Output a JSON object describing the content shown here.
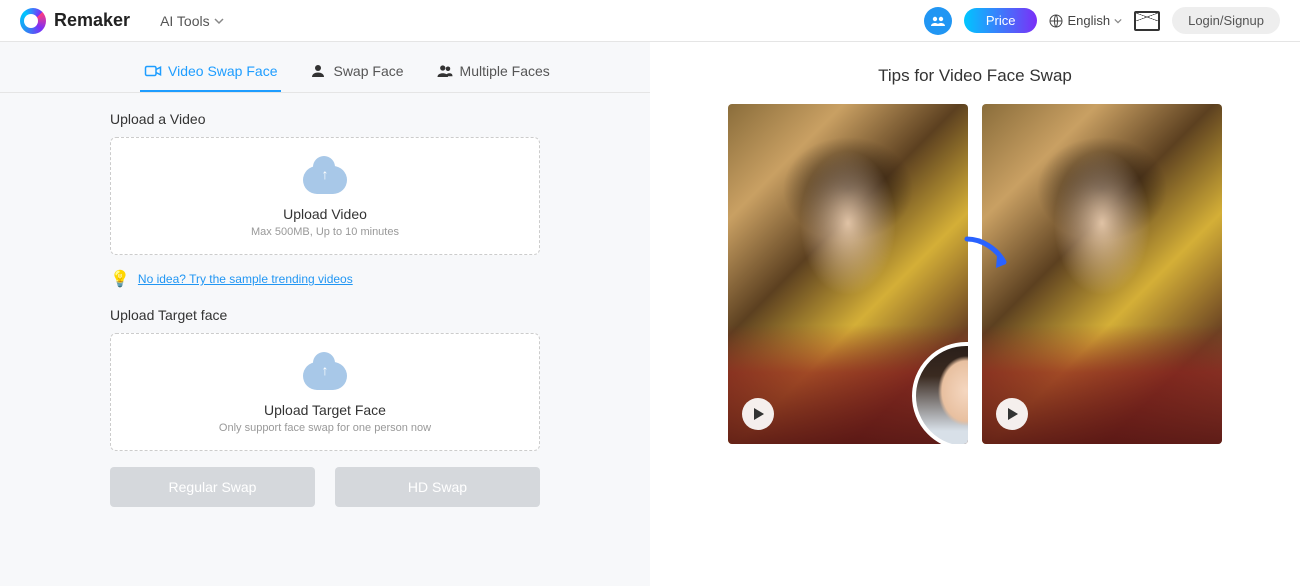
{
  "header": {
    "brand": "Remaker",
    "ai_tools": "AI Tools",
    "price": "Price",
    "language": "English",
    "login": "Login/Signup"
  },
  "tabs": {
    "video_swap": "Video Swap Face",
    "swap_face": "Swap Face",
    "multiple": "Multiple Faces"
  },
  "upload_video": {
    "section": "Upload a Video",
    "title": "Upload Video",
    "sub": "Max 500MB, Up to 10 minutes"
  },
  "hint": "No idea? Try the sample trending videos",
  "upload_face": {
    "section": "Upload Target face",
    "title": "Upload Target Face",
    "sub": "Only support face swap for one person now"
  },
  "buttons": {
    "regular": "Regular Swap",
    "hd": "HD Swap"
  },
  "tips_title": "Tips for Video Face Swap"
}
